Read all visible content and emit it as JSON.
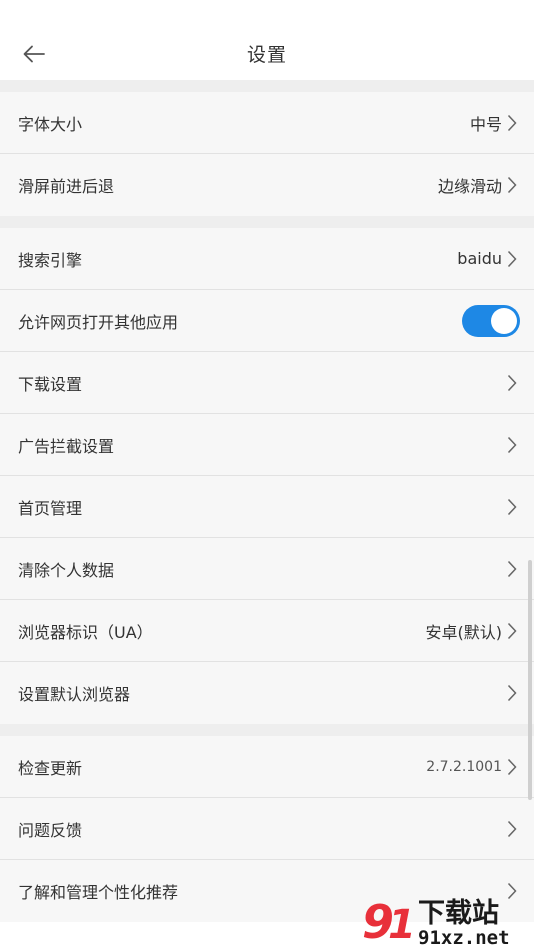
{
  "header": {
    "title": "设置"
  },
  "groups": [
    {
      "rows": [
        {
          "label": "字体大小",
          "value": "中号"
        },
        {
          "label": "滑屏前进后退",
          "value": "边缘滑动"
        }
      ]
    },
    {
      "rows": [
        {
          "label": "搜索引擎",
          "value": "baidu"
        },
        {
          "label": "允许网页打开其他应用",
          "toggle": true
        },
        {
          "label": "下载设置",
          "value": ""
        },
        {
          "label": "广告拦截设置",
          "value": ""
        },
        {
          "label": "首页管理",
          "value": ""
        },
        {
          "label": "清除个人数据",
          "value": ""
        },
        {
          "label": "浏览器标识（UA）",
          "value": "安卓(默认)"
        },
        {
          "label": "设置默认浏览器",
          "value": ""
        }
      ]
    },
    {
      "rows": [
        {
          "label": "检查更新",
          "value": "2.7.2.1001"
        },
        {
          "label": "问题反馈",
          "value": ""
        },
        {
          "label": "了解和管理个性化推荐",
          "value": ""
        }
      ]
    }
  ],
  "watermark": {
    "top": "下载站",
    "bottom": "91xz.net"
  },
  "colors": {
    "accent": "#1e88e5",
    "background": "#f7f7f7",
    "divider": "#e2e2e2"
  }
}
